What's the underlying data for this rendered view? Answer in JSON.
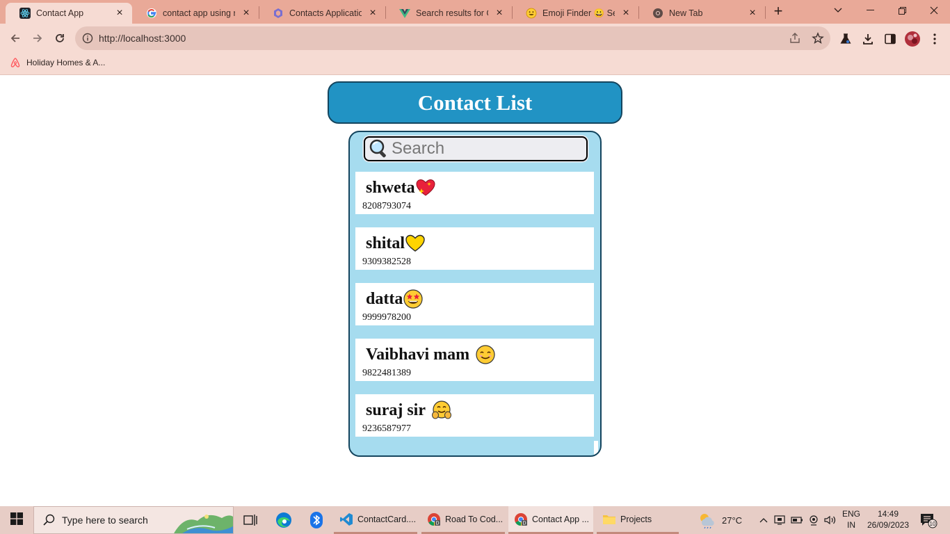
{
  "browser": {
    "tabs": [
      {
        "title": "Contact App",
        "active": true,
        "icon": "react-icon"
      },
      {
        "title": "contact app using rea",
        "active": false,
        "icon": "google-icon"
      },
      {
        "title": "Contacts Application",
        "active": false,
        "icon": "hexagon-app-icon"
      },
      {
        "title": "Search results for Gro",
        "active": false,
        "icon": "vue-icon"
      },
      {
        "title": "Emoji Finder 😀 Sear",
        "active": false,
        "icon": "smiley-icon"
      },
      {
        "title": "New Tab",
        "active": false,
        "icon": "chrome-icon"
      }
    ],
    "url": "http://localhost:3000",
    "bookmarks": [
      {
        "label": "Holiday Homes & A...",
        "icon": "airbnb-icon"
      }
    ]
  },
  "app": {
    "title": "Contact List",
    "search_placeholder": "Search",
    "contacts": [
      {
        "name": "shweta",
        "emoji": "💖",
        "phone": "8208793074"
      },
      {
        "name": "shital",
        "emoji": "💛",
        "phone": "9309382528"
      },
      {
        "name": "datta",
        "emoji": "🤩",
        "phone": "9999978200"
      },
      {
        "name": "Vaibhavi mam",
        "emoji": "😊",
        "phone": "9822481389"
      },
      {
        "name": "suraj sir",
        "emoji": "🤗",
        "phone": "9236587977"
      }
    ]
  },
  "taskbar": {
    "search_placeholder": "Type here to search",
    "apps": [
      {
        "label": "ContactCard....",
        "icon": "vscode-icon"
      },
      {
        "label": "Road To Cod...",
        "icon": "chrome-icon"
      },
      {
        "label": "Contact App ...",
        "icon": "chrome-icon",
        "active": true
      },
      {
        "label": "Projects",
        "icon": "folder-icon"
      }
    ],
    "weather": "27°C",
    "lang_line1": "ENG",
    "lang_line2": "IN",
    "time": "14:49",
    "date": "26/09/2023",
    "notifications": "10"
  },
  "colors": {
    "tabstrip": "#e9a998",
    "toolbar": "#f6dbd3",
    "header_bg": "#2193c4",
    "panel_bg": "#a6dcef",
    "border_dark": "#14455e"
  }
}
